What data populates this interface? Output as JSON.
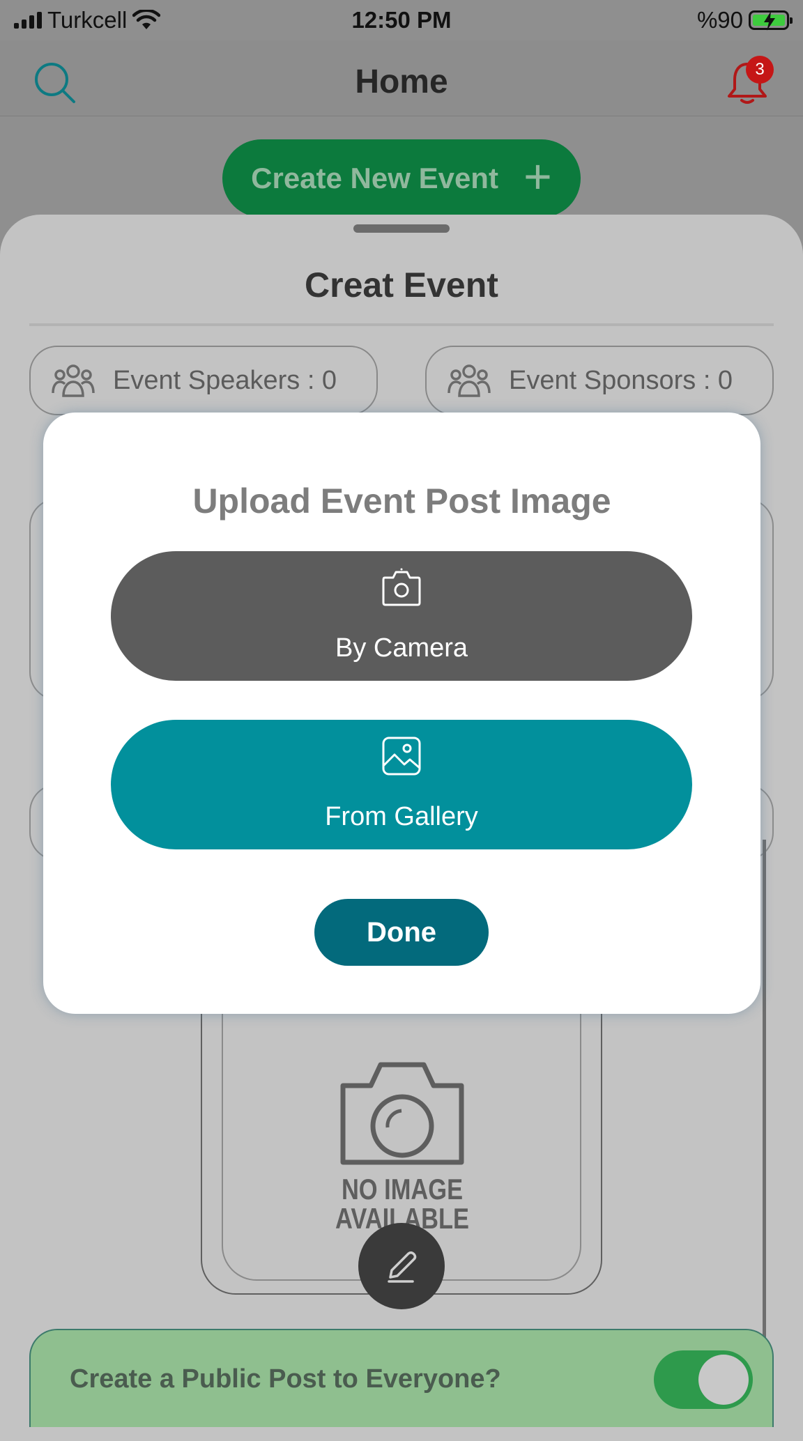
{
  "status_bar": {
    "carrier": "Turkcell",
    "time": "12:50 PM",
    "battery": "%90"
  },
  "nav": {
    "title": "Home",
    "notification_count": "3"
  },
  "create_event_button": {
    "label": "Create New Event",
    "icon": "plus-icon"
  },
  "sheet": {
    "title": "Creat Event",
    "speakers_label": "Event Speakers : 0",
    "sponsors_label": "Event Sponsors : 0",
    "no_image_line1": "NO IMAGE",
    "no_image_line2": "AVAILABLE",
    "public_post_label": "Create a Public Post to Everyone?",
    "public_post_enabled": true
  },
  "modal": {
    "title": "Upload Event Post Image",
    "camera_label": "By Camera",
    "gallery_label": "From Gallery",
    "done_label": "Done"
  },
  "colors": {
    "brand_green": "#0c7a3d",
    "teal": "#02909c",
    "dark_teal": "#036a7c",
    "badge_red": "#c51616"
  }
}
